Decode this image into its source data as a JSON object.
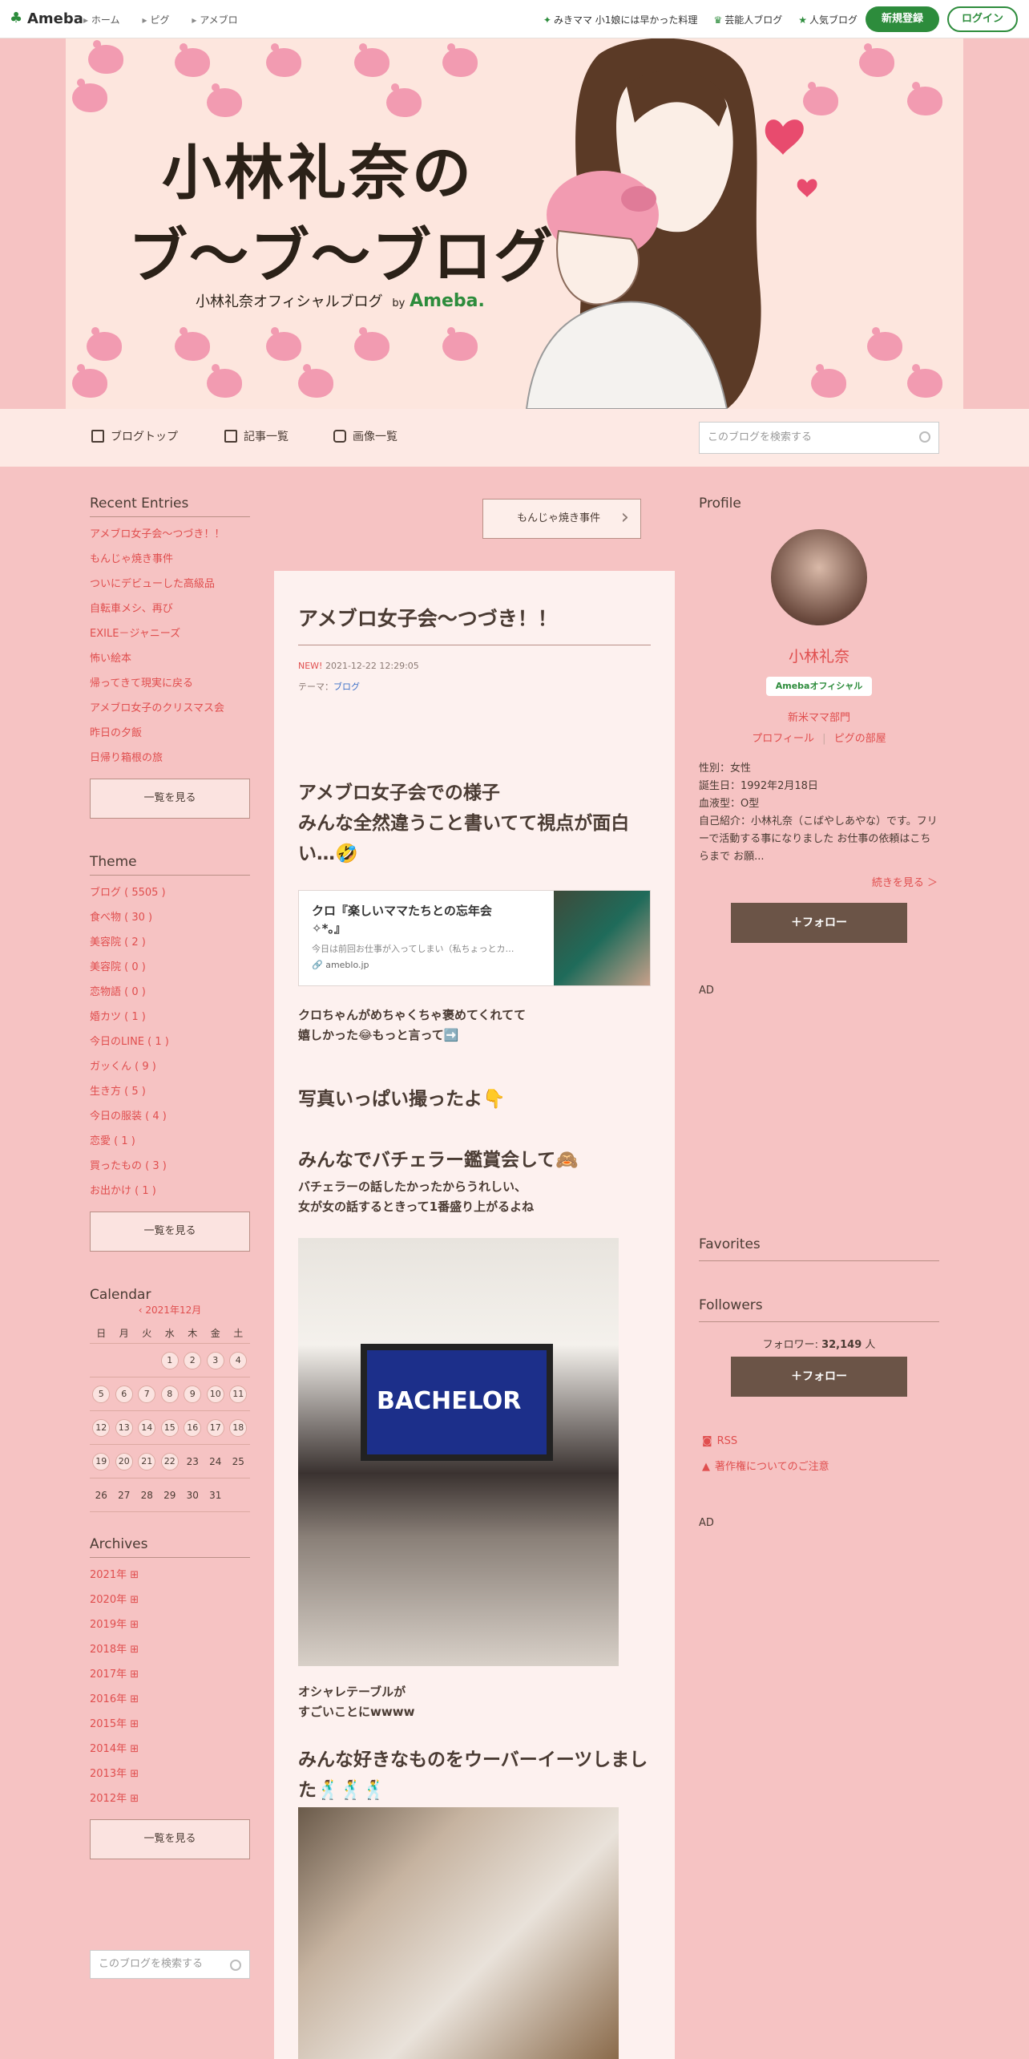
{
  "topbar": {
    "logo": "Ameba",
    "crumbs": [
      "ホーム",
      "ピグ",
      "アメブロ"
    ],
    "links": [
      {
        "icon": "sparkle-icon",
        "label": "みきママ 小1娘には早かった料理"
      },
      {
        "icon": "crown-icon",
        "label": "芸能人ブログ"
      },
      {
        "icon": "star-icon",
        "label": "人気ブログ"
      }
    ],
    "register": "新規登録",
    "login": "ログイン"
  },
  "banner": {
    "title_line1": "小林礼奈の",
    "title_line2": "ブ〜ブ〜ブログ",
    "subtitle": "小林礼奈オフィシャルブログ",
    "by": "by",
    "brand": "Ameba."
  },
  "nav": {
    "items": [
      "ブログトップ",
      "記事一覧",
      "画像一覧"
    ],
    "search_placeholder": "このブログを検索する"
  },
  "left": {
    "recent": {
      "title": "Recent Entries",
      "items": [
        "アメブロ女子会〜つづき！！",
        "もんじゃ焼き事件",
        "ついにデビューした高級品",
        "自転車メシ、再び",
        "EXILE－ジャニーズ",
        "怖い絵本",
        "帰ってきて現実に戻る",
        "アメブロ女子のクリスマス会",
        "昨日の夕飯",
        "日帰り箱根の旅"
      ],
      "more": "一覧を見る"
    },
    "theme": {
      "title": "Theme",
      "items": [
        "ブログ ( 5505 )",
        "食べ物 ( 30 )",
        "美容院 ( 2 )",
        "美容院 ( 0 )",
        "恋物語 ( 0 )",
        "婚カツ ( 1 )",
        "今日のLINE ( 1 )",
        "ガッくん ( 9 )",
        "生き方 ( 5 )",
        "今日の服装 ( 4 )",
        "恋愛 ( 1 )",
        "買ったもの ( 3 )",
        "お出かけ ( 1 )"
      ],
      "more": "一覧を見る"
    },
    "calendar": {
      "title": "Calendar",
      "month": "2021年12月",
      "weekdays": [
        "日",
        "月",
        "火",
        "水",
        "木",
        "金",
        "土"
      ],
      "weeks": [
        [
          "",
          "",
          "",
          "1",
          "2",
          "3",
          "4"
        ],
        [
          "5",
          "6",
          "7",
          "8",
          "9",
          "10",
          "11"
        ],
        [
          "12",
          "13",
          "14",
          "15",
          "16",
          "17",
          "18"
        ],
        [
          "19",
          "20",
          "21",
          "22",
          "23",
          "24",
          "25"
        ],
        [
          "26",
          "27",
          "28",
          "29",
          "30",
          "31",
          ""
        ]
      ],
      "posted_through": 22
    },
    "archives": {
      "title": "Archives",
      "items": [
        "2021年",
        "2020年",
        "2019年",
        "2018年",
        "2017年",
        "2016年",
        "2015年",
        "2014年",
        "2013年",
        "2012年"
      ],
      "more": "一覧を見る"
    },
    "search_placeholder": "このブログを検索する"
  },
  "article": {
    "prev_label": "もんじゃ焼き事件",
    "title": "アメブロ女子会〜つづき！！",
    "new_label": "NEW!",
    "date": "2021-12-22 12:29:05",
    "theme_label": "テーマ：",
    "theme": "ブログ",
    "heading1": "アメブロ女子会での様子\nみんな全然違うこと書いてて視点が面白い…🤣",
    "card": {
      "title": "クロ『楽しいママたちとの忘年会✧*。』",
      "desc": "今日は前回お仕事が入ってしまい（私ちょっとカ…",
      "domain": "ameblo.jp"
    },
    "para1": "クロちゃんがめちゃくちゃ褒めてくれてて\n嬉しかった😂もっと言って➡️",
    "heading2": "写真いっぱい撮ったよ👇",
    "heading3": "みんなでバチェラー鑑賞会して🙈",
    "para2": "バチェラーの話したかったからうれしい、\n女が女の話するときって1番盛り上がるよね",
    "tv_text": "BACHELOR",
    "para3": "オシャレテーブルが\nすごいことにwwww",
    "heading4": "みんな好きなものをウーバーイーツしました🕺🕺🕺"
  },
  "right": {
    "profile": {
      "title": "Profile",
      "name": "小林礼奈",
      "badge": "Amebaオフィシャル",
      "category": "新米ママ部門",
      "link1": "プロフィール",
      "link2": "ピグの部屋",
      "info": "性別：女性\n誕生日：1992年2月18日\n血液型：O型\n自己紹介：小林礼奈（こばやしあやな）です。フリーで活動する事になりました お仕事の依頼はこちらまで お願...",
      "more": "続きを見る ＞",
      "follow": "＋フォロー"
    },
    "ad1": "AD",
    "favorites": "Favorites",
    "followers": {
      "title": "Followers",
      "label": "フォロワー:",
      "count": "32,149",
      "unit": "人",
      "follow": "＋フォロー"
    },
    "rss": "RSS",
    "copyright": "著作権についてのご注意",
    "ad2": "AD"
  },
  "colors": {
    "accent": "#2d8c3c",
    "link": "#e04e4e",
    "background": "#f6c3c3",
    "follow_button": "#6b5447"
  }
}
